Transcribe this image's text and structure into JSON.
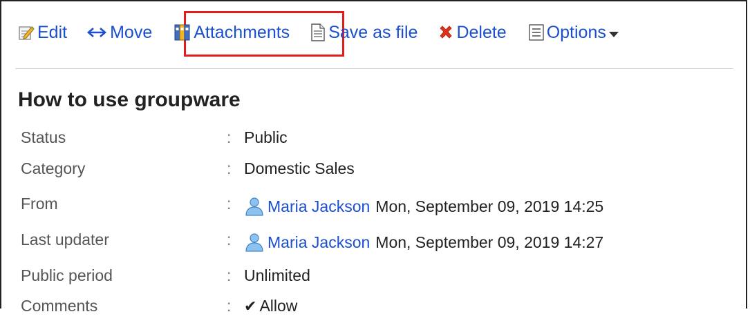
{
  "toolbar": {
    "edit": "Edit",
    "move": "Move",
    "attachments": "Attachments",
    "save_as_file": "Save as file",
    "delete": "Delete",
    "options": "Options"
  },
  "title": "How to use groupware",
  "fields": {
    "status": {
      "label": "Status",
      "value": "Public"
    },
    "category": {
      "label": "Category",
      "value": "Domestic Sales"
    },
    "from": {
      "label": "From",
      "user": "Maria Jackson",
      "datetime": "Mon, September 09, 2019 14:25"
    },
    "last_updater": {
      "label": "Last updater",
      "user": "Maria Jackson",
      "datetime": "Mon, September 09, 2019 14:27"
    },
    "public_period": {
      "label": "Public period",
      "value": "Unlimited"
    },
    "comments": {
      "label": "Comments",
      "value": "Allow"
    }
  },
  "colon": ":",
  "colors": {
    "link": "#1a4fd0",
    "highlight": "#e21b1b",
    "delete_icon": "#e0321b"
  }
}
